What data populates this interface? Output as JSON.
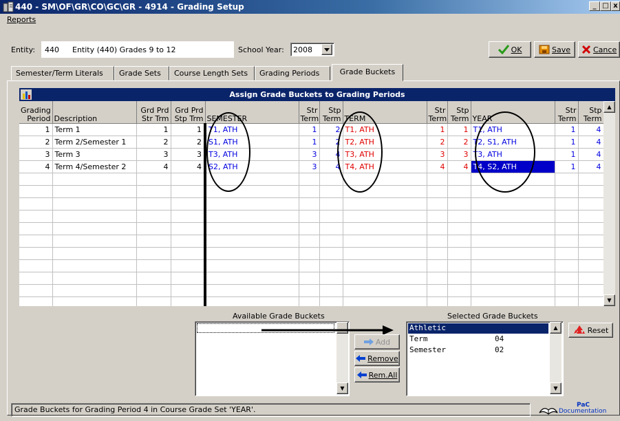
{
  "window": {
    "title": "440 - SM\\OF\\GR\\CO\\GC\\GR - 4914 - Grading Setup",
    "minimize": "_",
    "maximize": "□",
    "close": "x"
  },
  "menu": {
    "reports_label": "Reports"
  },
  "entity": {
    "label": "Entity:",
    "code": "440",
    "name": "Entity (440) Grades 9 to 12",
    "school_year_label": "School Year:",
    "school_year": "2008"
  },
  "toolbar": {
    "ok_label": "OK",
    "save_label": "Save",
    "cancel_label": "Cance"
  },
  "tabs": [
    {
      "label": "Semester/Term Literals"
    },
    {
      "label": "Grade Sets"
    },
    {
      "label": "Course Length Sets"
    },
    {
      "label": "Grading Periods"
    },
    {
      "label": "Grade Buckets"
    }
  ],
  "active_tab": "Grade Buckets",
  "grid": {
    "caption": "Assign Grade Buckets to Grading Periods",
    "headers": {
      "grading_period": [
        "Grading",
        "Period"
      ],
      "description": "Description",
      "grd_prd_str": [
        "Grd Prd",
        "Str Trm"
      ],
      "grd_prd_stp": [
        "Grd Prd",
        "Stp Trm"
      ],
      "semester": "SEMESTER",
      "str_term": [
        "Str",
        "Term"
      ],
      "stp_term": [
        "Stp",
        "Term"
      ],
      "term": "TERM",
      "year": "YEAR"
    },
    "rows": [
      {
        "period": "1",
        "description": "Term 1",
        "str": "1",
        "stp": "1",
        "semester": "T1, ATH",
        "sem_str": "1",
        "sem_stp": "2",
        "term": "T1, ATH",
        "term_str": "1",
        "term_stp": "1",
        "year": "T1, ATH",
        "year_str": "1",
        "year_stp": "4"
      },
      {
        "period": "2",
        "description": "Term 2/Semester 1",
        "str": "2",
        "stp": "2",
        "semester": "S1, ATH",
        "sem_str": "1",
        "sem_stp": "2",
        "term": "T2, ATH",
        "term_str": "2",
        "term_stp": "2",
        "year": "T2, S1, ATH",
        "year_str": "1",
        "year_stp": "4"
      },
      {
        "period": "3",
        "description": "Term 3",
        "str": "3",
        "stp": "3",
        "semester": "T3, ATH",
        "sem_str": "3",
        "sem_stp": "4",
        "term": "T3, ATH",
        "term_str": "3",
        "term_stp": "3",
        "year": "T3, ATH",
        "year_str": "1",
        "year_stp": "4"
      },
      {
        "period": "4",
        "description": "Term 4/Semester 2",
        "str": "4",
        "stp": "4",
        "semester": "S2, ATH",
        "sem_str": "3",
        "sem_stp": "4",
        "term": "T4, ATH",
        "term_str": "4",
        "term_stp": "4",
        "year": "T4, S2, ATH",
        "year_str": "1",
        "year_stp": "4"
      }
    ]
  },
  "available": {
    "label": "Available Grade Buckets"
  },
  "buttons": {
    "add": "Add",
    "remove": "Remove",
    "remove_all": "Rem.All",
    "reset": "Reset"
  },
  "selected": {
    "label": "Selected Grade Buckets",
    "items": [
      {
        "name": "Athletic",
        "value": ""
      },
      {
        "name": "Term",
        "value": "04"
      },
      {
        "name": "Semester",
        "value": "02"
      }
    ]
  },
  "status": {
    "text": "Grade Buckets for Grading Period 4 in Course Grade Set 'YEAR'.",
    "doc_line1": "PaC",
    "doc_line2": "Documentation"
  },
  "colors": {
    "title_bar": "#0a246a",
    "grid_caption": "#0a246a",
    "blue_text": "#0000e0",
    "red_text": "#e00000",
    "selection": "#0000c8"
  }
}
